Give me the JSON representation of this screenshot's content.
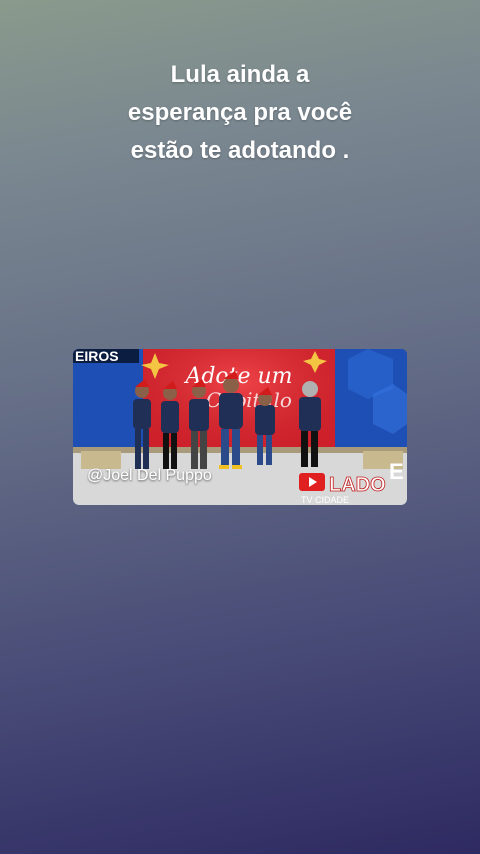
{
  "caption": {
    "line1": "Lula ainda a",
    "line2": "esperança pra você",
    "line3": "estão te adotando ."
  },
  "video": {
    "watermark": "@Joel Del Puppo",
    "sign_text_1": "Adote um",
    "sign_text_2": "Capitulo",
    "corner_text": "EIROS",
    "logo_text": "LADO",
    "logo_letter": "E",
    "logo_sub": "TV CIDADE"
  },
  "colors": {
    "caption_text": "#ffffff",
    "sign_red": "#d8242e",
    "studio_blue": "#1e4fb5"
  }
}
